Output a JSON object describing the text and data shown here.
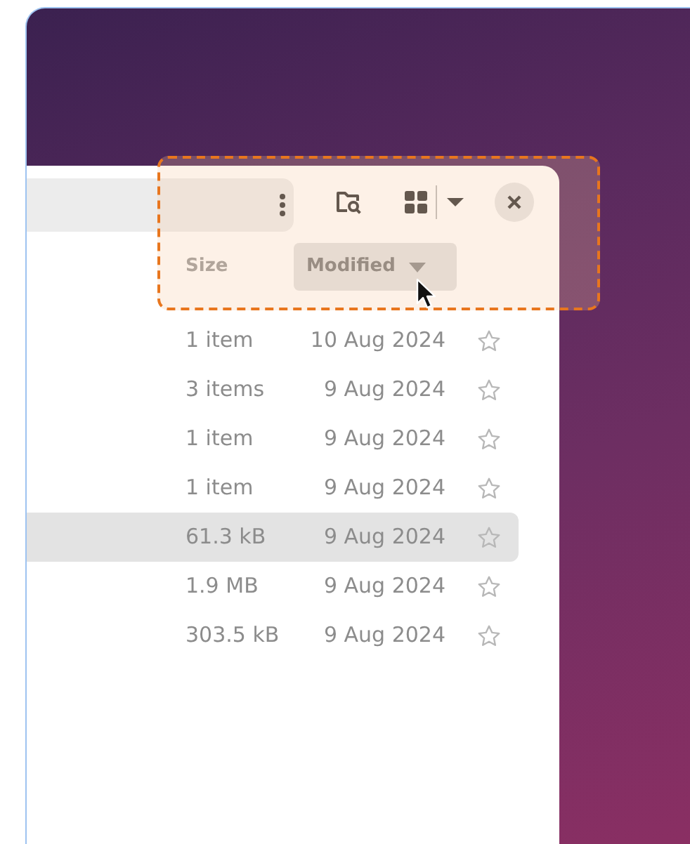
{
  "columns": [
    {
      "label": "Size",
      "highlighted": false,
      "sorted": false
    },
    {
      "label": "Modified",
      "highlighted": true,
      "sorted": true
    }
  ],
  "rows": [
    {
      "size": "1 item",
      "modified": "10 Aug 2024",
      "selected": false,
      "starred": false
    },
    {
      "size": "3 items",
      "modified": "9 Aug 2024",
      "selected": false,
      "starred": false
    },
    {
      "size": "1 item",
      "modified": "9 Aug 2024",
      "selected": false,
      "starred": false
    },
    {
      "size": "1 item",
      "modified": "9 Aug 2024",
      "selected": false,
      "starred": false
    },
    {
      "size": "61.3 kB",
      "modified": "9 Aug 2024",
      "selected": true,
      "starred": false
    },
    {
      "size": "1.9 MB",
      "modified": "9 Aug 2024",
      "selected": false,
      "starred": false
    },
    {
      "size": "303.5 kB",
      "modified": "9 Aug 2024",
      "selected": false,
      "starred": false
    }
  ]
}
